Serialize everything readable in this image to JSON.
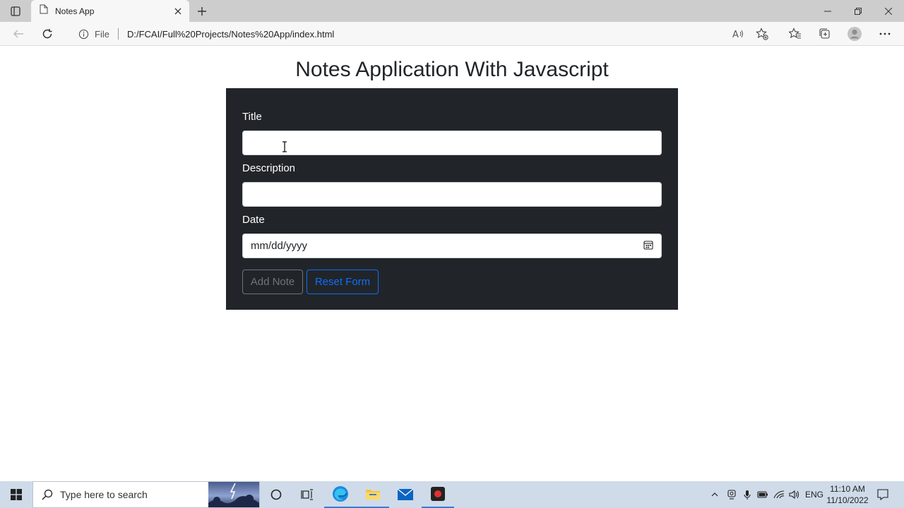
{
  "browser": {
    "tab_title": "Notes App",
    "address_prefix": "File",
    "url": "D:/FCAI/Full%20Projects/Notes%20App/index.html"
  },
  "page": {
    "title": "Notes Application With Javascript",
    "form": {
      "title_label": "Title",
      "title_value": "",
      "description_label": "Description",
      "description_value": "",
      "date_label": "Date",
      "date_placeholder": "mm/dd/yyyy",
      "add_button": "Add Note",
      "reset_button": "Reset Form"
    }
  },
  "taskbar": {
    "search_placeholder": "Type here to search",
    "language": "ENG",
    "time": "11:10 AM",
    "date": "11/10/2022"
  },
  "colors": {
    "card_bg": "#212529",
    "primary": "#0d6efd",
    "secondary": "#6c757d"
  }
}
